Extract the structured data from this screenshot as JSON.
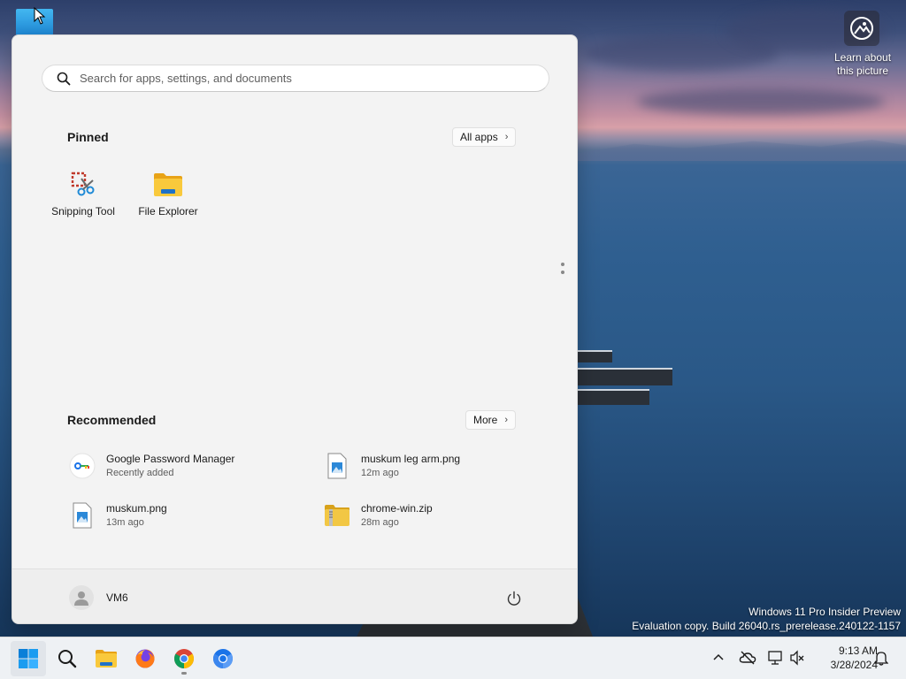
{
  "desktop": {
    "learn_label_line1": "Learn about",
    "learn_label_line2": "this picture",
    "watermark_line1": "Windows 11 Pro Insider Preview",
    "watermark_line2": "Evaluation copy. Build 26040.rs_prerelease.240122-1157"
  },
  "start_menu": {
    "search_placeholder": "Search for apps, settings, and documents",
    "pinned_title": "Pinned",
    "all_apps_label": "All apps",
    "pinned_apps": [
      {
        "label": "Snipping Tool",
        "icon": "snipping-tool-icon"
      },
      {
        "label": "File Explorer",
        "icon": "file-explorer-icon"
      }
    ],
    "recommended_title": "Recommended",
    "more_label": "More",
    "recommended": [
      {
        "name": "Google Password Manager",
        "sub": "Recently added",
        "icon": "key-icon"
      },
      {
        "name": "muskum leg arm.png",
        "sub": "12m ago",
        "icon": "image-file-icon"
      },
      {
        "name": "muskum.png",
        "sub": "13m ago",
        "icon": "image-file-icon"
      },
      {
        "name": "chrome-win.zip",
        "sub": "28m ago",
        "icon": "zip-folder-icon"
      }
    ],
    "user_name": "VM6"
  },
  "taskbar": {
    "apps": [
      "start-icon",
      "search-icon",
      "file-explorer-icon",
      "firefox-icon",
      "chrome-icon",
      "chromium-icon"
    ],
    "time": "9:13 AM",
    "date": "3/28/2024"
  },
  "colors": {
    "accent": "#0067c0",
    "menu_bg": "#f3f3f3",
    "taskbar_bg": "#eef1f4"
  }
}
